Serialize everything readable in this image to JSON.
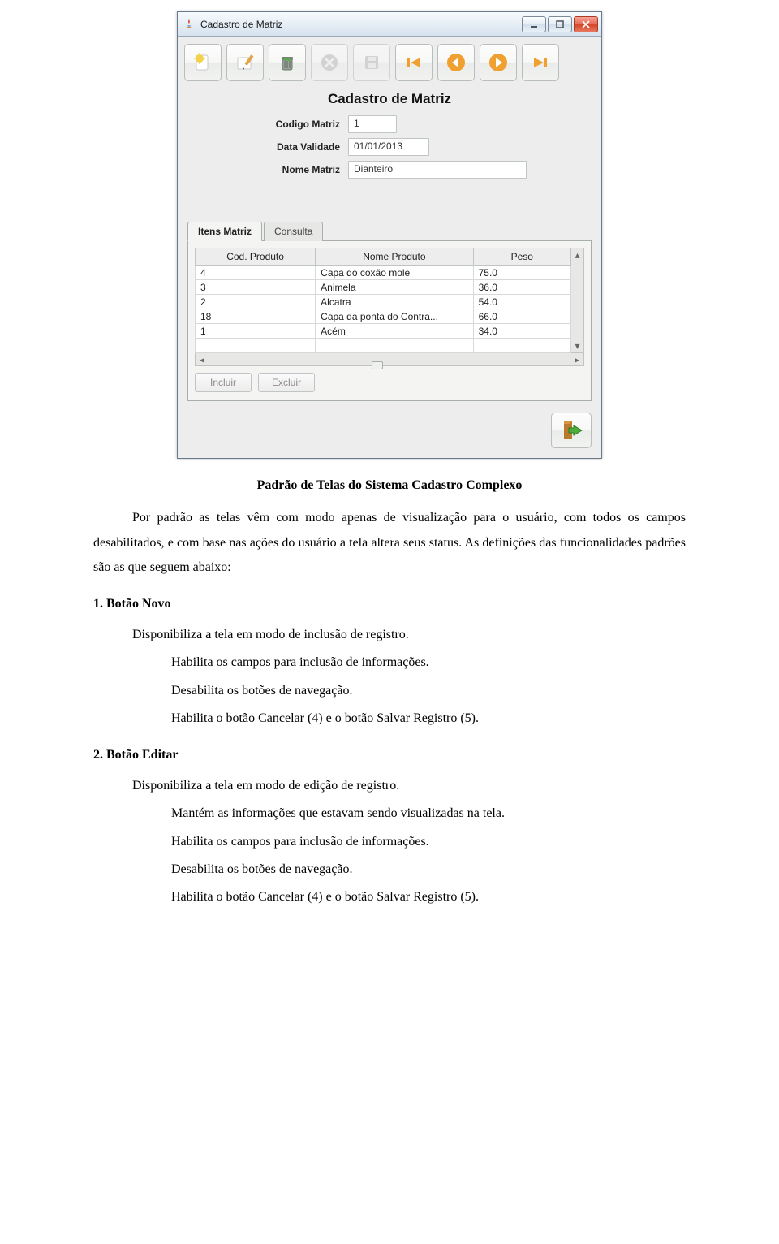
{
  "window": {
    "title": "Cadastro de Matriz"
  },
  "toolbar": {
    "new_icon": "new",
    "edit_icon": "edit",
    "delete_icon": "trash",
    "cancel_icon": "cancel",
    "save_icon": "save",
    "first_icon": "first",
    "prev_icon": "prev",
    "next_icon": "next",
    "last_icon": "last"
  },
  "form": {
    "title": "Cadastro de Matriz",
    "fields": {
      "codigo_label": "Codigo Matriz",
      "codigo_value": "1",
      "validade_label": "Data Validade",
      "validade_value": "01/01/2013",
      "nome_label": "Nome Matriz",
      "nome_value": "Dianteiro"
    }
  },
  "tabs": {
    "itens_label": "Itens Matriz",
    "consulta_label": "Consulta"
  },
  "table": {
    "headers": {
      "cod": "Cod. Produto",
      "nome": "Nome Produto",
      "peso": "Peso"
    },
    "rows": [
      {
        "cod": "4",
        "nome": "Capa do coxão mole",
        "peso": "75.0"
      },
      {
        "cod": "3",
        "nome": "Animela",
        "peso": "36.0"
      },
      {
        "cod": "2",
        "nome": "Alcatra",
        "peso": "54.0"
      },
      {
        "cod": "18",
        "nome": "Capa da ponta do Contra...",
        "peso": "66.0"
      },
      {
        "cod": "1",
        "nome": "Acém",
        "peso": "34.0"
      }
    ]
  },
  "panel_buttons": {
    "incluir": "Incluir",
    "excluir": "Excluir"
  },
  "document": {
    "caption": "Padrão de Telas do Sistema Cadastro Complexo",
    "intro": "Por padrão as telas vêm com modo apenas de visualização para o usuário, com todos os campos desabilitados, e com base nas ações do usuário a tela altera seus status. As definições das funcionalidades padrões são as que seguem abaixo:",
    "sec1_title": "1. Botão Novo",
    "sec1_line1": "Disponibiliza a tela em modo de inclusão de registro.",
    "sec1_line2": "Habilita os campos para inclusão de informações.",
    "sec1_line3": "Desabilita os botões de navegação.",
    "sec1_line4": "Habilita o botão Cancelar (4)  e o botão Salvar Registro (5).",
    "sec2_title": "2. Botão Editar",
    "sec2_line1": "Disponibiliza a tela em modo de edição de registro.",
    "sec2_line2": "Mantém as informações que estavam sendo visualizadas na tela.",
    "sec2_line3": "Habilita os campos para inclusão de informações.",
    "sec2_line4": "Desabilita os botões de navegação.",
    "sec2_line5": "Habilita o botão Cancelar (4)  e o botão Salvar Registro (5)."
  }
}
